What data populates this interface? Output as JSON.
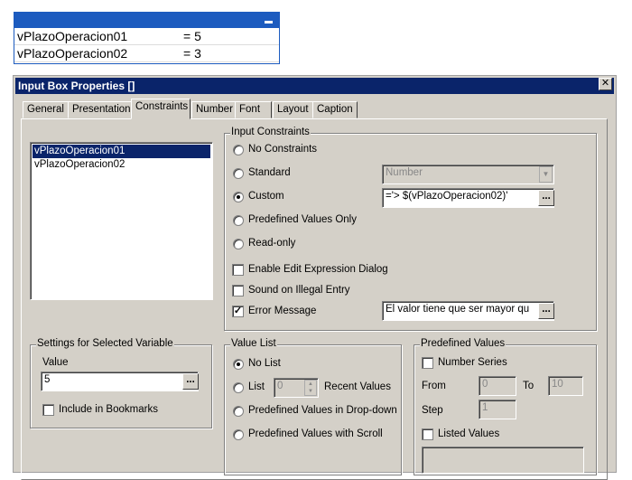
{
  "widget": {
    "rows": [
      {
        "name": "vPlazoOperacion01",
        "value": "= 5"
      },
      {
        "name": "vPlazoOperacion02",
        "value": "= 3"
      }
    ]
  },
  "dialog": {
    "title": "Input Box Properties []",
    "close": "✕",
    "tabs": [
      "General",
      "Presentation",
      "Constraints",
      "Number",
      "Font",
      "Layout",
      "Caption"
    ],
    "active_tab": "Constraints",
    "variables": [
      "vPlazoOperacion01",
      "vPlazoOperacion02"
    ],
    "input_constraints": {
      "label": "Input Constraints",
      "no_constraints": "No Constraints",
      "standard": "Standard",
      "standard_value": "Number",
      "custom": "Custom",
      "custom_value": "='> $(vPlazoOperacion02)'",
      "predefined_only": "Predefined Values Only",
      "read_only": "Read-only",
      "enable_edit": "Enable Edit Expression Dialog",
      "sound": "Sound on Illegal Entry",
      "error_message": "Error Message",
      "error_value": "El valor tiene que ser mayor qu",
      "selected": "Custom"
    },
    "settings": {
      "label": "Settings for Selected Variable",
      "value_label": "Value",
      "value": "5",
      "bookmarks": "Include in Bookmarks"
    },
    "value_list": {
      "label": "Value List",
      "no_list": "No List",
      "list": "List",
      "list_count": "0",
      "recent": "Recent Values",
      "dropdown": "Predefined Values in Drop-down",
      "scroll": "Predefined Values with Scroll"
    },
    "predefined": {
      "label": "Predefined Values",
      "number_series": "Number Series",
      "from": "From",
      "from_value": "0",
      "to": "To",
      "to_value": "10",
      "step": "Step",
      "step_value": "1",
      "listed": "Listed Values"
    },
    "dots": "..."
  }
}
